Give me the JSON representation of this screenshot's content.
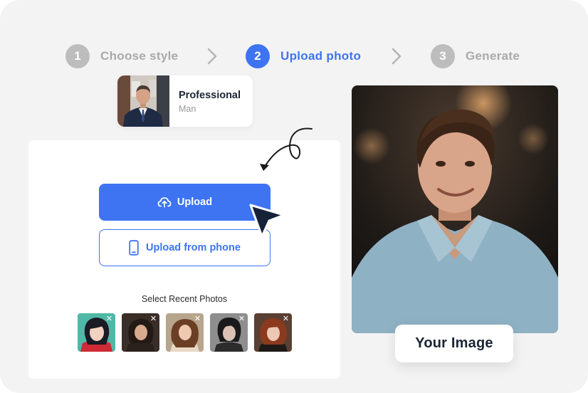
{
  "steps": [
    {
      "number": "1",
      "label": "Choose style",
      "state": "inactive"
    },
    {
      "number": "2",
      "label": "Upload photo",
      "state": "active"
    },
    {
      "number": "3",
      "label": "Generate",
      "state": "inactive"
    }
  ],
  "style_card": {
    "name": "Professional",
    "subtitle": "Man"
  },
  "upload": {
    "upload_label": "Upload",
    "phone_label": "Upload from phone",
    "recent_label": "Select Recent Photos",
    "remove_glyph": "✕"
  },
  "photo_caption": "Your Image",
  "colors": {
    "accent": "#3e74f2",
    "inactive": "#bdbdbd",
    "background": "#f3f3f4"
  },
  "icons": [
    "chevron-right-icon",
    "cloud-upload-icon",
    "phone-icon",
    "close-icon",
    "pointer-cursor-icon",
    "curly-arrow-icon"
  ]
}
